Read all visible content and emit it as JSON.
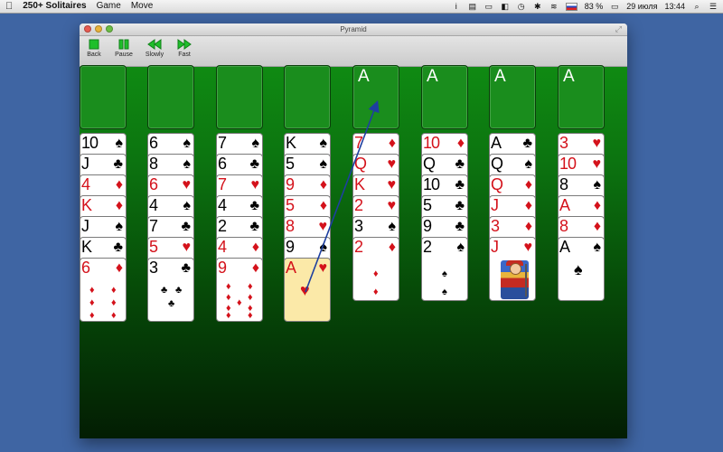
{
  "menubar": {
    "app_name": "250+ Solitaires",
    "menus": [
      "Game",
      "Move"
    ],
    "battery": "83 %",
    "date": "29 июля",
    "time": "13:44"
  },
  "window": {
    "title": "Pyramid"
  },
  "toolbar": {
    "back": "Back",
    "pause": "Pause",
    "slowly": "Slowly",
    "fast": "Fast",
    "accent": "#1fbf2b"
  },
  "colors": {
    "felt_top": "#0f8a12",
    "felt_bottom": "#031d03",
    "red_suit": "#d4121b",
    "arrow": "#1e3fa0"
  },
  "foundations": [
    {
      "label": ""
    },
    {
      "label": ""
    },
    {
      "label": ""
    },
    {
      "label": ""
    },
    {
      "label": "A"
    },
    {
      "label": "A"
    },
    {
      "label": "A"
    },
    {
      "label": "A"
    }
  ],
  "tableau": [
    [
      {
        "rank": "10",
        "suit": "♠",
        "color": "black"
      },
      {
        "rank": "J",
        "suit": "♣",
        "color": "black"
      },
      {
        "rank": "4",
        "suit": "♦",
        "color": "red"
      },
      {
        "rank": "K",
        "suit": "♦",
        "color": "red"
      },
      {
        "rank": "J",
        "suit": "♠",
        "color": "black"
      },
      {
        "rank": "K",
        "suit": "♣",
        "color": "black"
      },
      {
        "rank": "6",
        "suit": "♦",
        "color": "red"
      }
    ],
    [
      {
        "rank": "6",
        "suit": "♠",
        "color": "black"
      },
      {
        "rank": "8",
        "suit": "♠",
        "color": "black"
      },
      {
        "rank": "6",
        "suit": "♥",
        "color": "red"
      },
      {
        "rank": "4",
        "suit": "♠",
        "color": "black"
      },
      {
        "rank": "7",
        "suit": "♣",
        "color": "black"
      },
      {
        "rank": "5",
        "suit": "♥",
        "color": "red"
      },
      {
        "rank": "3",
        "suit": "♣",
        "color": "black"
      }
    ],
    [
      {
        "rank": "7",
        "suit": "♠",
        "color": "black"
      },
      {
        "rank": "6",
        "suit": "♣",
        "color": "black"
      },
      {
        "rank": "7",
        "suit": "♥",
        "color": "red"
      },
      {
        "rank": "4",
        "suit": "♣",
        "color": "black"
      },
      {
        "rank": "2",
        "suit": "♣",
        "color": "black"
      },
      {
        "rank": "4",
        "suit": "♦",
        "color": "red"
      },
      {
        "rank": "9",
        "suit": "♦",
        "color": "red"
      }
    ],
    [
      {
        "rank": "K",
        "suit": "♠",
        "color": "black"
      },
      {
        "rank": "5",
        "suit": "♠",
        "color": "black"
      },
      {
        "rank": "9",
        "suit": "♦",
        "color": "red"
      },
      {
        "rank": "5",
        "suit": "♦",
        "color": "red"
      },
      {
        "rank": "8",
        "suit": "♥",
        "color": "red"
      },
      {
        "rank": "9",
        "suit": "♠",
        "color": "black"
      },
      {
        "rank": "A",
        "suit": "♥",
        "color": "red",
        "highlighted": true
      }
    ],
    [
      {
        "rank": "7",
        "suit": "♦",
        "color": "red"
      },
      {
        "rank": "Q",
        "suit": "♥",
        "color": "red"
      },
      {
        "rank": "K",
        "suit": "♥",
        "color": "red"
      },
      {
        "rank": "2",
        "suit": "♥",
        "color": "red"
      },
      {
        "rank": "3",
        "suit": "♠",
        "color": "black"
      },
      {
        "rank": "2",
        "suit": "♦",
        "color": "red"
      }
    ],
    [
      {
        "rank": "10",
        "suit": "♦",
        "color": "red"
      },
      {
        "rank": "Q",
        "suit": "♣",
        "color": "black"
      },
      {
        "rank": "10",
        "suit": "♣",
        "color": "black"
      },
      {
        "rank": "5",
        "suit": "♣",
        "color": "black"
      },
      {
        "rank": "9",
        "suit": "♣",
        "color": "black"
      },
      {
        "rank": "2",
        "suit": "♠",
        "color": "black"
      }
    ],
    [
      {
        "rank": "A",
        "suit": "♣",
        "color": "black"
      },
      {
        "rank": "Q",
        "suit": "♠",
        "color": "black"
      },
      {
        "rank": "Q",
        "suit": "♦",
        "color": "red"
      },
      {
        "rank": "J",
        "suit": "♦",
        "color": "red"
      },
      {
        "rank": "3",
        "suit": "♦",
        "color": "red"
      },
      {
        "rank": "J",
        "suit": "♥",
        "color": "red"
      }
    ],
    [
      {
        "rank": "3",
        "suit": "♥",
        "color": "red"
      },
      {
        "rank": "10",
        "suit": "♥",
        "color": "red"
      },
      {
        "rank": "8",
        "suit": "♠",
        "color": "black"
      },
      {
        "rank": "A",
        "suit": "♦",
        "color": "red"
      },
      {
        "rank": "8",
        "suit": "♦",
        "color": "red"
      },
      {
        "rank": "A",
        "suit": "♠",
        "color": "black"
      }
    ]
  ]
}
